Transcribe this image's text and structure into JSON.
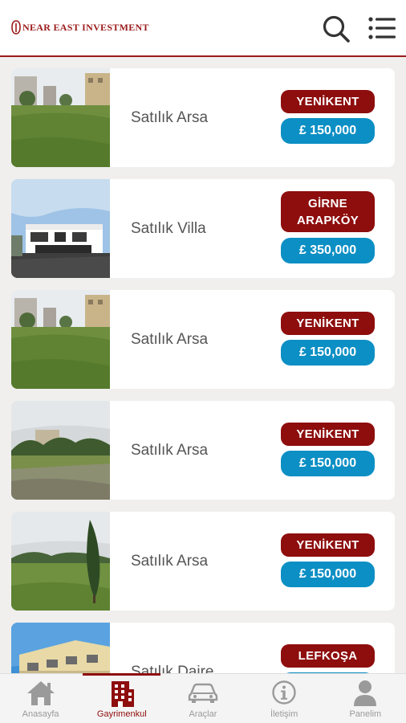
{
  "header": {
    "logo_text": "NEAR EAST INVESTMENT",
    "search_icon": "search-icon",
    "menu_icon": "menu-list-icon"
  },
  "listings": [
    {
      "title": "Satılık Arsa",
      "location_lines": [
        "YENİKENT"
      ],
      "price": "£ 150,000",
      "image": "land-with-buildings"
    },
    {
      "title": "Satılık Villa",
      "location_lines": [
        "GİRNE",
        "ARAPKÖY"
      ],
      "price": "£ 350,000",
      "image": "modern-villa"
    },
    {
      "title": "Satılık Arsa",
      "location_lines": [
        "YENİKENT"
      ],
      "price": "£ 150,000",
      "image": "land-with-buildings"
    },
    {
      "title": "Satılık Arsa",
      "location_lines": [
        "YENİKENT"
      ],
      "price": "£ 150,000",
      "image": "land-with-trees"
    },
    {
      "title": "Satılık Arsa",
      "location_lines": [
        "YENİKENT"
      ],
      "price": "£ 150,000",
      "image": "land-with-cypress"
    },
    {
      "title": "Satılık Daire",
      "location_lines": [
        "LEFKOŞA"
      ],
      "price": "",
      "image": "apartment-building"
    }
  ],
  "bottom_nav": [
    {
      "label": "Anasayfa",
      "icon": "home-icon",
      "active": false
    },
    {
      "label": "Gayrimenkul",
      "icon": "building-icon",
      "active": true
    },
    {
      "label": "Araçlar",
      "icon": "car-icon",
      "active": false
    },
    {
      "label": "İletişim",
      "icon": "info-icon",
      "active": false
    },
    {
      "label": "Panelim",
      "icon": "user-icon",
      "active": false
    }
  ],
  "colors": {
    "brand_red": "#8e0d0d",
    "price_blue": "#0c8fc4",
    "active_nav": "#8e0d0d"
  }
}
